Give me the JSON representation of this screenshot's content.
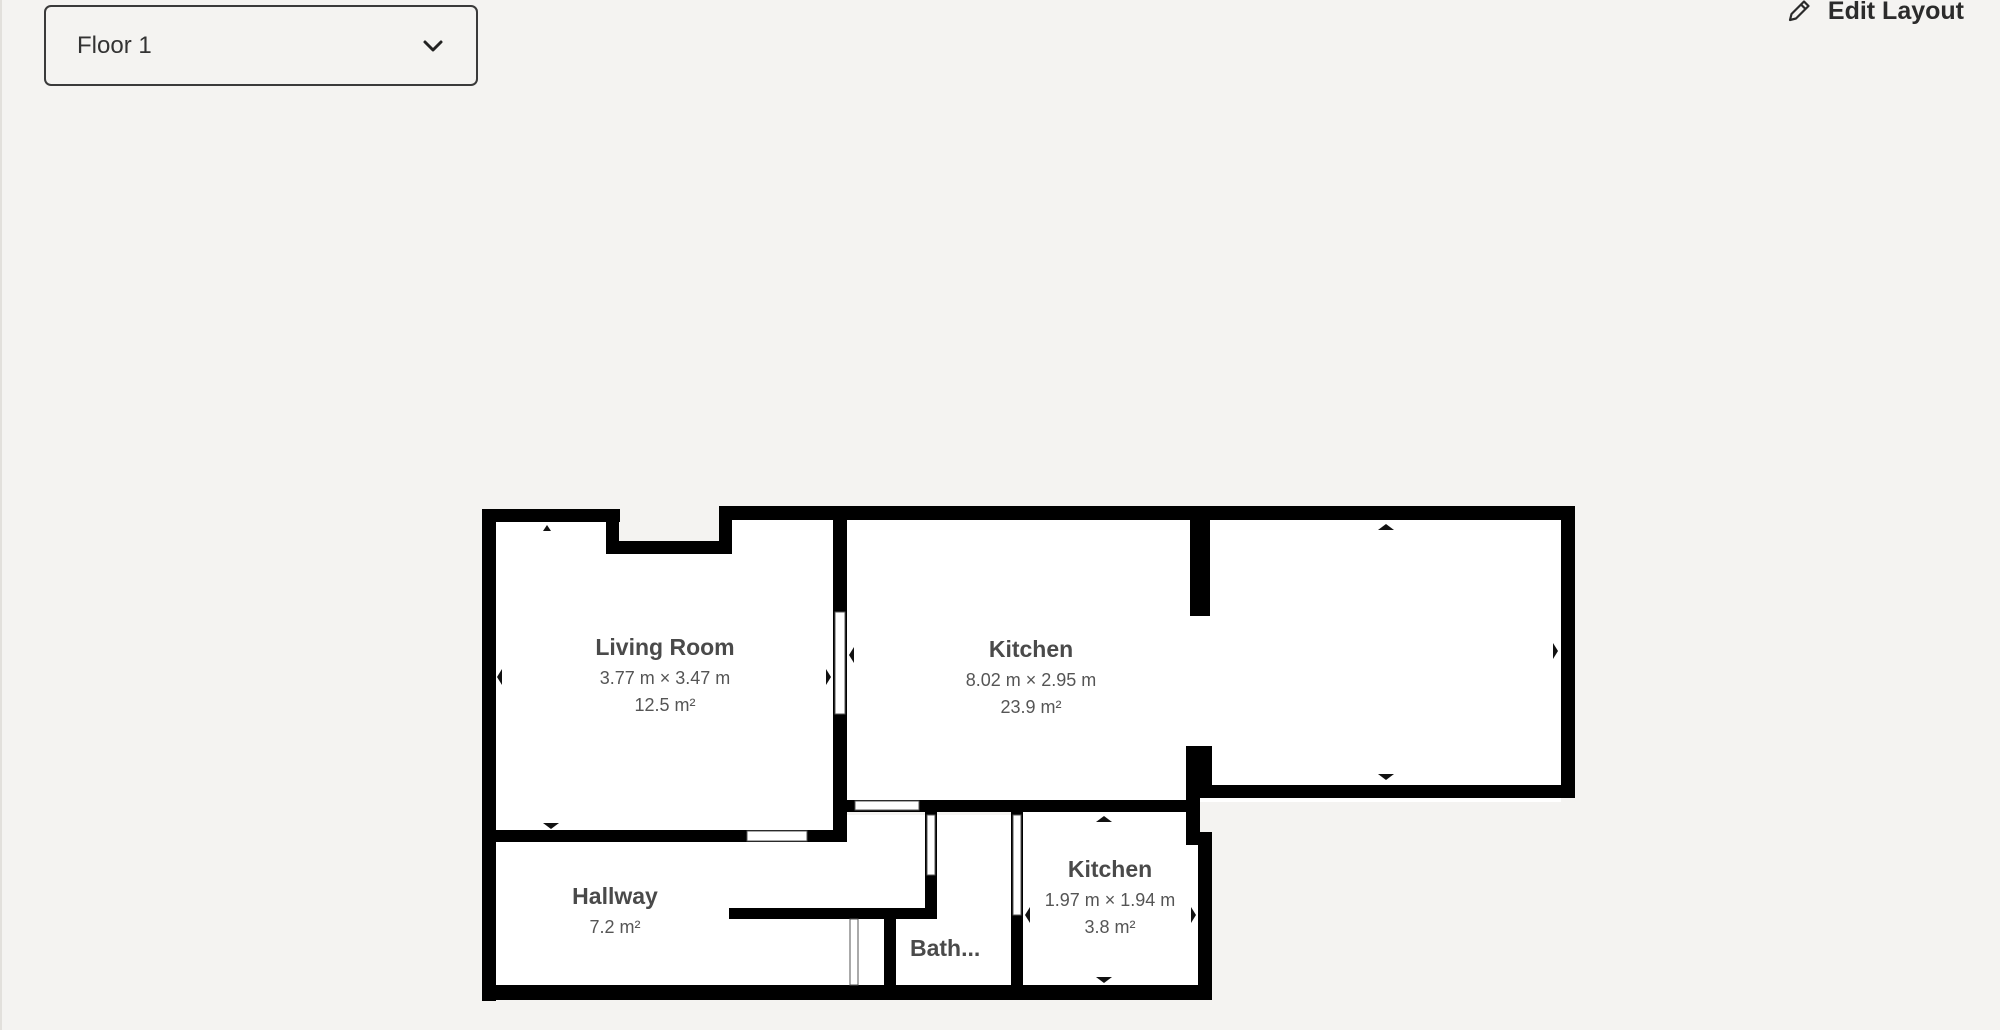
{
  "floor_selector": {
    "selected": "Floor 1",
    "icon": "chevron-down-icon"
  },
  "edit_layout": {
    "label": "Edit Layout",
    "icon": "pencil-icon"
  },
  "rooms": {
    "living_room": {
      "name": "Living Room",
      "dimensions": "3.77 m × 3.47 m",
      "area": "12.5 m²"
    },
    "kitchen_main": {
      "name": "Kitchen",
      "dimensions": "8.02 m × 2.95 m",
      "area": "23.9 m²"
    },
    "hallway": {
      "name": "Hallway",
      "area": "7.2 m²"
    },
    "bathroom": {
      "name": "Bath..."
    },
    "kitchen_small": {
      "name": "Kitchen",
      "dimensions": "1.97 m × 1.94 m",
      "area": "3.8 m²"
    }
  },
  "colors": {
    "background": "#f4f3f1",
    "wall": "#000000",
    "room_fill": "#ffffff",
    "label_text": "#4a4a4a"
  }
}
